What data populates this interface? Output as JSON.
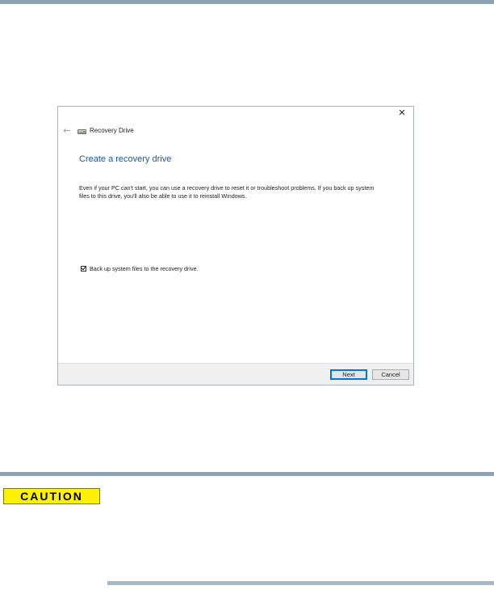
{
  "window": {
    "title": "Recovery Drive",
    "close_glyph": "✕",
    "back_glyph": "←"
  },
  "page": {
    "heading": "Create a recovery drive",
    "description": "Even if your PC can't start, you can use a recovery drive to reset it or troubleshoot problems. If you back up system files to this drive, you'll also be able to use it to reinstall Windows.",
    "backup_checkbox": {
      "label": "Back up system files to the recovery drive.",
      "checked": true
    }
  },
  "buttons": {
    "next": "Next",
    "cancel": "Cancel"
  },
  "caution": {
    "label": "CAUTION"
  },
  "icons": {
    "close": "close-icon",
    "back": "back-arrow-icon",
    "drive": "drive-icon"
  },
  "colors": {
    "heading": "#1c5aa2",
    "rule": "#8ea1b3",
    "caution_bg": "#fff200",
    "primary_button_border": "#0078d7"
  }
}
